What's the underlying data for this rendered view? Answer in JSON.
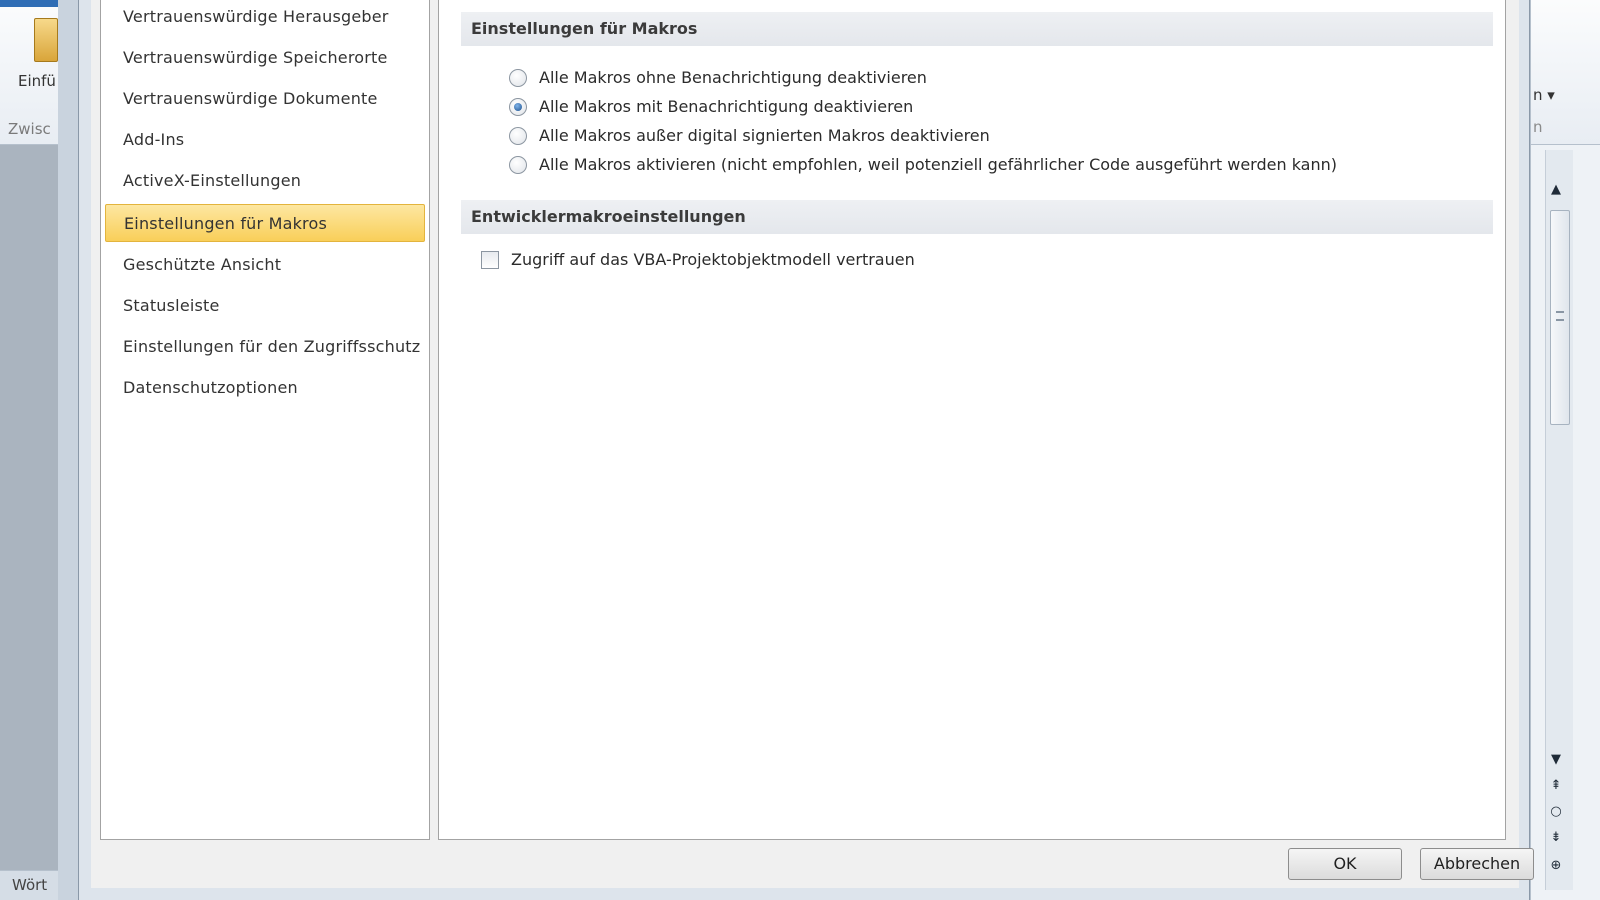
{
  "background_left": {
    "ribbon_button_label": "Einfü",
    "ribbon_group_label": "Zwisc",
    "status_text": "Wört"
  },
  "background_right": {
    "ribbon_fragment": "n ▾",
    "ribbon_fragment2": "n"
  },
  "dialog": {
    "nav_items": [
      {
        "label": "Vertrauenswürdige Herausgeber",
        "selected": false
      },
      {
        "label": "Vertrauenswürdige Speicherorte",
        "selected": false
      },
      {
        "label": "Vertrauenswürdige Dokumente",
        "selected": false
      },
      {
        "label": "Add-Ins",
        "selected": false
      },
      {
        "label": "ActiveX-Einstellungen",
        "selected": false
      },
      {
        "label": "Einstellungen für Makros",
        "selected": true
      },
      {
        "label": "Geschützte Ansicht",
        "selected": false
      },
      {
        "label": "Statusleiste",
        "selected": false
      },
      {
        "label": "Einstellungen für den Zugriffsschutz",
        "selected": false
      },
      {
        "label": "Datenschutzoptionen",
        "selected": false
      }
    ],
    "macro_section": {
      "heading": "Einstellungen für Makros",
      "options": [
        {
          "label": "Alle Makros ohne Benachrichtigung deaktivieren",
          "checked": false
        },
        {
          "label": "Alle Makros mit Benachrichtigung deaktivieren",
          "checked": true
        },
        {
          "label": "Alle Makros außer digital signierten Makros deaktivieren",
          "checked": false
        },
        {
          "label": "Alle Makros aktivieren (nicht empfohlen, weil potenziell gefährlicher Code ausgeführt werden kann)",
          "checked": false
        }
      ]
    },
    "developer_section": {
      "heading": "Entwicklermakroeinstellungen",
      "vba_checkbox_label": "Zugriff auf das VBA-Projektobjektmodell vertrauen",
      "vba_checked": false
    },
    "buttons": {
      "ok": "OK",
      "cancel": "Abbrechen"
    }
  }
}
